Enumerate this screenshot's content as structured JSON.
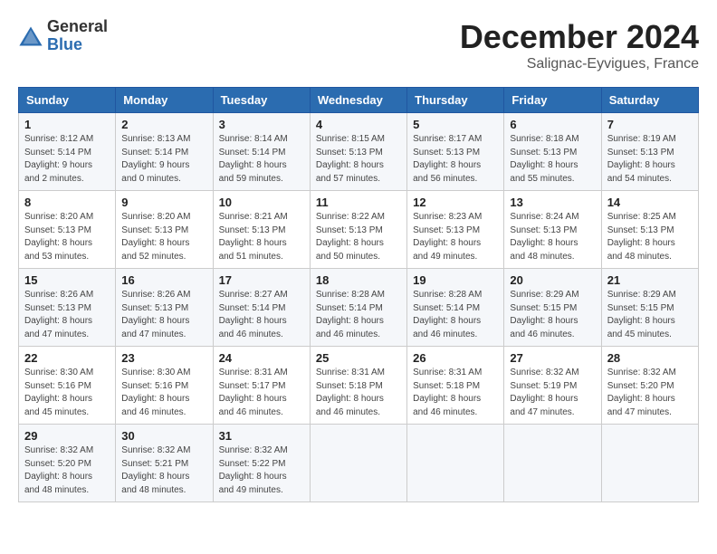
{
  "logo": {
    "general": "General",
    "blue": "Blue"
  },
  "header": {
    "month": "December 2024",
    "location": "Salignac-Eyvigues, France"
  },
  "weekdays": [
    "Sunday",
    "Monday",
    "Tuesday",
    "Wednesday",
    "Thursday",
    "Friday",
    "Saturday"
  ],
  "weeks": [
    [
      {
        "day": "1",
        "sunrise": "8:12 AM",
        "sunset": "5:14 PM",
        "daylight": "9 hours and 2 minutes."
      },
      {
        "day": "2",
        "sunrise": "8:13 AM",
        "sunset": "5:14 PM",
        "daylight": "9 hours and 0 minutes."
      },
      {
        "day": "3",
        "sunrise": "8:14 AM",
        "sunset": "5:14 PM",
        "daylight": "8 hours and 59 minutes."
      },
      {
        "day": "4",
        "sunrise": "8:15 AM",
        "sunset": "5:13 PM",
        "daylight": "8 hours and 57 minutes."
      },
      {
        "day": "5",
        "sunrise": "8:17 AM",
        "sunset": "5:13 PM",
        "daylight": "8 hours and 56 minutes."
      },
      {
        "day": "6",
        "sunrise": "8:18 AM",
        "sunset": "5:13 PM",
        "daylight": "8 hours and 55 minutes."
      },
      {
        "day": "7",
        "sunrise": "8:19 AM",
        "sunset": "5:13 PM",
        "daylight": "8 hours and 54 minutes."
      }
    ],
    [
      {
        "day": "8",
        "sunrise": "8:20 AM",
        "sunset": "5:13 PM",
        "daylight": "8 hours and 53 minutes."
      },
      {
        "day": "9",
        "sunrise": "8:20 AM",
        "sunset": "5:13 PM",
        "daylight": "8 hours and 52 minutes."
      },
      {
        "day": "10",
        "sunrise": "8:21 AM",
        "sunset": "5:13 PM",
        "daylight": "8 hours and 51 minutes."
      },
      {
        "day": "11",
        "sunrise": "8:22 AM",
        "sunset": "5:13 PM",
        "daylight": "8 hours and 50 minutes."
      },
      {
        "day": "12",
        "sunrise": "8:23 AM",
        "sunset": "5:13 PM",
        "daylight": "8 hours and 49 minutes."
      },
      {
        "day": "13",
        "sunrise": "8:24 AM",
        "sunset": "5:13 PM",
        "daylight": "8 hours and 48 minutes."
      },
      {
        "day": "14",
        "sunrise": "8:25 AM",
        "sunset": "5:13 PM",
        "daylight": "8 hours and 48 minutes."
      }
    ],
    [
      {
        "day": "15",
        "sunrise": "8:26 AM",
        "sunset": "5:13 PM",
        "daylight": "8 hours and 47 minutes."
      },
      {
        "day": "16",
        "sunrise": "8:26 AM",
        "sunset": "5:13 PM",
        "daylight": "8 hours and 47 minutes."
      },
      {
        "day": "17",
        "sunrise": "8:27 AM",
        "sunset": "5:14 PM",
        "daylight": "8 hours and 46 minutes."
      },
      {
        "day": "18",
        "sunrise": "8:28 AM",
        "sunset": "5:14 PM",
        "daylight": "8 hours and 46 minutes."
      },
      {
        "day": "19",
        "sunrise": "8:28 AM",
        "sunset": "5:14 PM",
        "daylight": "8 hours and 46 minutes."
      },
      {
        "day": "20",
        "sunrise": "8:29 AM",
        "sunset": "5:15 PM",
        "daylight": "8 hours and 46 minutes."
      },
      {
        "day": "21",
        "sunrise": "8:29 AM",
        "sunset": "5:15 PM",
        "daylight": "8 hours and 45 minutes."
      }
    ],
    [
      {
        "day": "22",
        "sunrise": "8:30 AM",
        "sunset": "5:16 PM",
        "daylight": "8 hours and 45 minutes."
      },
      {
        "day": "23",
        "sunrise": "8:30 AM",
        "sunset": "5:16 PM",
        "daylight": "8 hours and 46 minutes."
      },
      {
        "day": "24",
        "sunrise": "8:31 AM",
        "sunset": "5:17 PM",
        "daylight": "8 hours and 46 minutes."
      },
      {
        "day": "25",
        "sunrise": "8:31 AM",
        "sunset": "5:18 PM",
        "daylight": "8 hours and 46 minutes."
      },
      {
        "day": "26",
        "sunrise": "8:31 AM",
        "sunset": "5:18 PM",
        "daylight": "8 hours and 46 minutes."
      },
      {
        "day": "27",
        "sunrise": "8:32 AM",
        "sunset": "5:19 PM",
        "daylight": "8 hours and 47 minutes."
      },
      {
        "day": "28",
        "sunrise": "8:32 AM",
        "sunset": "5:20 PM",
        "daylight": "8 hours and 47 minutes."
      }
    ],
    [
      {
        "day": "29",
        "sunrise": "8:32 AM",
        "sunset": "5:20 PM",
        "daylight": "8 hours and 48 minutes."
      },
      {
        "day": "30",
        "sunrise": "8:32 AM",
        "sunset": "5:21 PM",
        "daylight": "8 hours and 48 minutes."
      },
      {
        "day": "31",
        "sunrise": "8:32 AM",
        "sunset": "5:22 PM",
        "daylight": "8 hours and 49 minutes."
      },
      null,
      null,
      null,
      null
    ]
  ]
}
